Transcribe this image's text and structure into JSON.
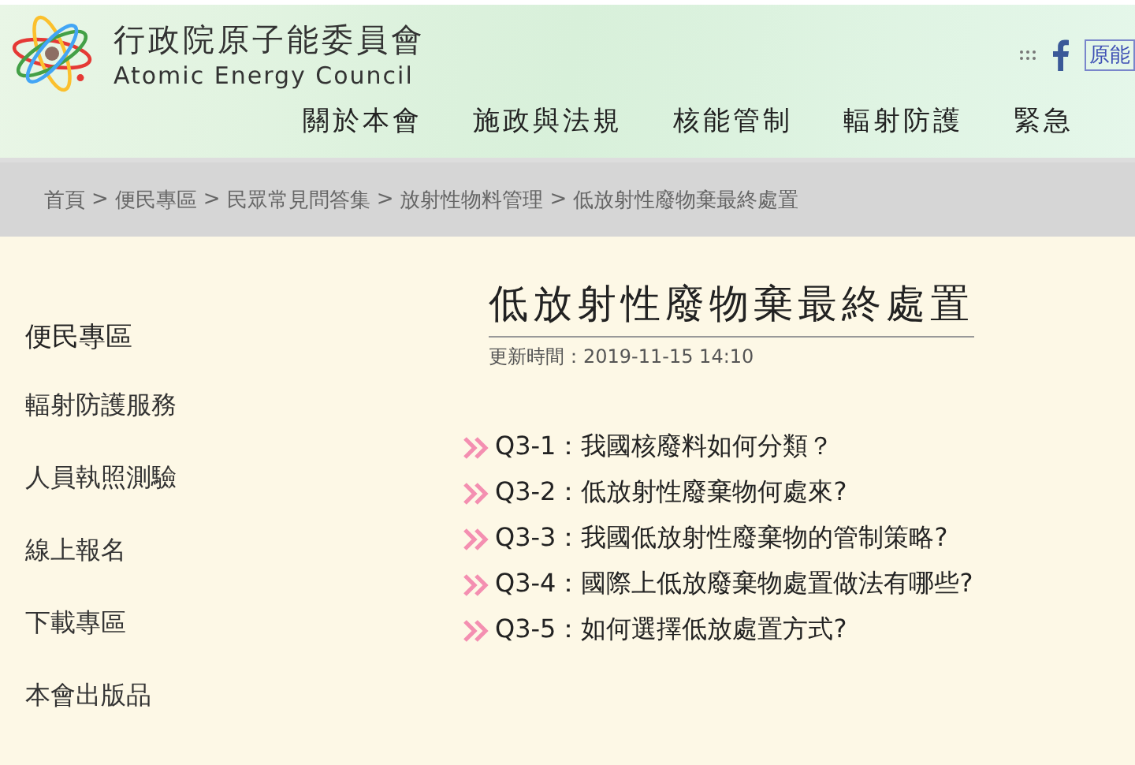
{
  "header": {
    "org_name": "行政院原子能委員會",
    "org_name_en": "Atomic Energy Council",
    "facebook_label": "原能"
  },
  "nav": [
    {
      "label": "關於本會"
    },
    {
      "label": "施政與法規"
    },
    {
      "label": "核能管制"
    },
    {
      "label": "輻射防護"
    },
    {
      "label": "緊急"
    }
  ],
  "breadcrumb": [
    {
      "label": "首頁"
    },
    {
      "separator": ">",
      "label": "便民專區"
    },
    {
      "separator": ">",
      "label": "民眾常見問答集"
    },
    {
      "separator": ">",
      "label": "放射性物料管理"
    },
    {
      "separator": ">",
      "label": "低放射性廢物棄最終處置"
    }
  ],
  "sidebar": {
    "title": "便民專區",
    "items": [
      "輻射防護服務",
      "人員執照測驗",
      "線上報名",
      "下載專區",
      "本會出版品"
    ]
  },
  "article": {
    "title": "低放射性廢物棄最終處置",
    "updated": "更新時間：2019-11-15 14:10",
    "questions": [
      "Q3-1：我國核廢料如何分類？",
      "Q3-2：低放射性廢棄物何處來?",
      "Q3-3：我國低放射性廢棄物的管制策略?",
      "Q3-4：國際上低放廢棄物處置做法有哪些?",
      "Q3-5：如何選擇低放處置方式?"
    ]
  }
}
